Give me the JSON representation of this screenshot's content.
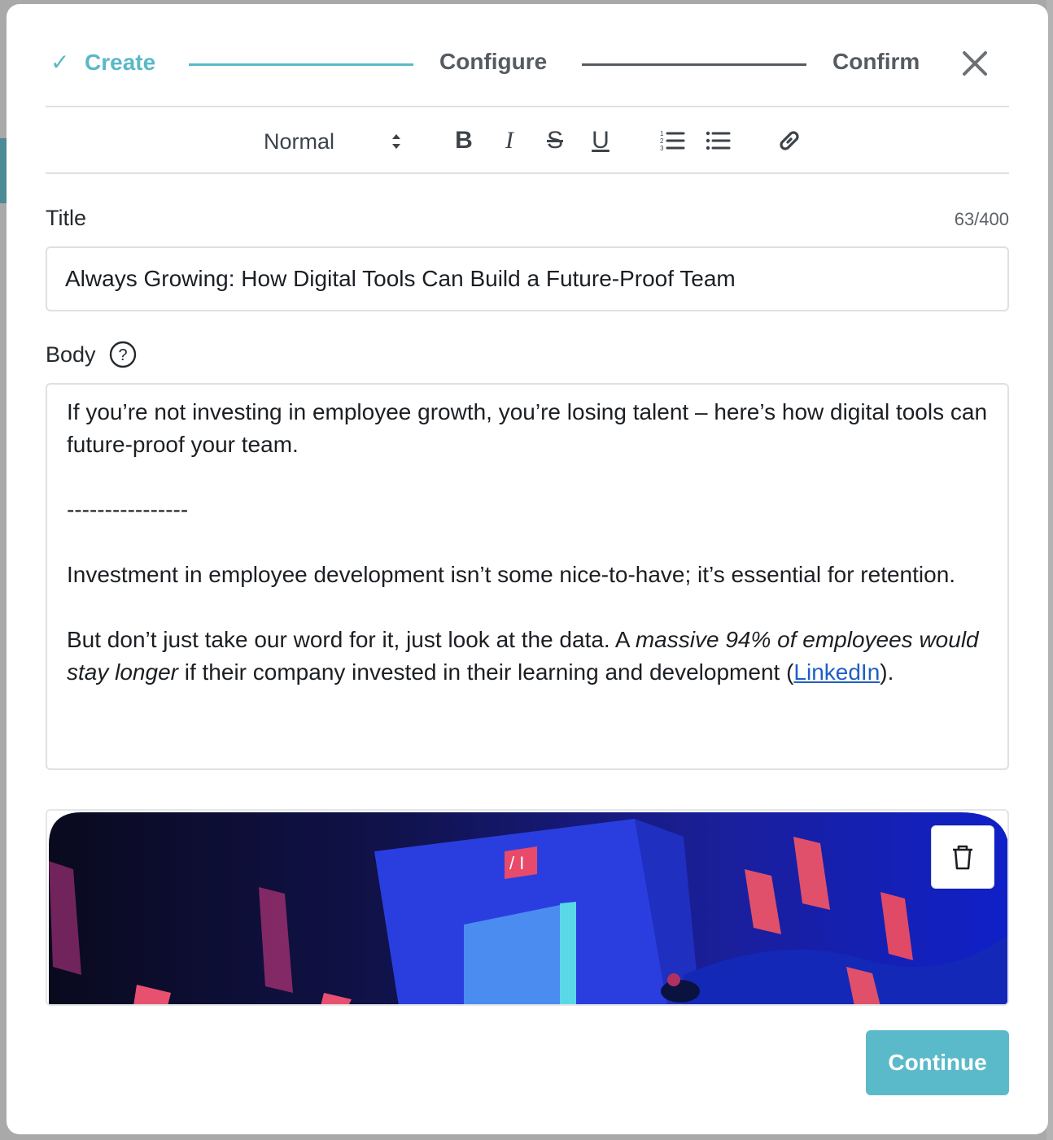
{
  "stepper": {
    "steps": [
      {
        "label": "Create",
        "state": "done"
      },
      {
        "label": "Configure",
        "state": "active"
      },
      {
        "label": "Confirm",
        "state": "pending"
      }
    ],
    "check_glyph": "✓",
    "close_icon": "close-icon"
  },
  "toolbar": {
    "text_style": "Normal",
    "buttons": [
      "bold-icon",
      "italic-icon",
      "strikethrough-icon",
      "underline-icon",
      "ordered-list-icon",
      "bullet-list-icon",
      "link-icon"
    ],
    "bold": "B",
    "italic": "I",
    "strike": "S",
    "underline": "U"
  },
  "title_field": {
    "label": "Title",
    "counter": "63/400",
    "value": "Always Growing: How Digital Tools Can Build a Future-Proof Team"
  },
  "body_field": {
    "label": "Body",
    "help_icon": "help-circle-icon",
    "p1": "If you’re not investing in employee growth, you’re losing talent – here’s how digital tools can future-proof your team.",
    "separator": "----------------",
    "p2": "Investment in employee development isn’t some nice-to-have; it’s essential for retention.",
    "p3_start": "But don’t just take our word for it, just look at the data. A ",
    "p3_italic": "massive 94% of employees would stay longer",
    "p3_mid": " if their company invested in their learning and development (",
    "p3_link": "LinkedIn",
    "p3_end": ")."
  },
  "image_preview": {
    "delete_icon": "trash-icon",
    "sign_text": "/ I"
  },
  "actions": {
    "continue": "Continue"
  },
  "colors": {
    "accent": "#5bb8c7",
    "text": "#24292e",
    "link": "#1f5fc4"
  }
}
